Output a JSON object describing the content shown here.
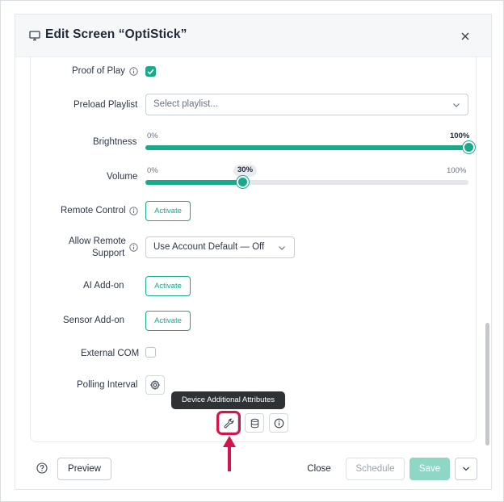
{
  "header": {
    "title": "Edit Screen “OptiStick”",
    "icons": {
      "title": "monitor-icon",
      "close": "close-icon"
    }
  },
  "settings": {
    "proof_of_play": {
      "label": "Proof of Play",
      "checked": true
    },
    "preload_playlist": {
      "label": "Preload Playlist",
      "placeholder": "Select playlist..."
    },
    "brightness": {
      "label": "Brightness",
      "min_label": "0%",
      "max_label": "100%",
      "value_percent": 100
    },
    "volume": {
      "label": "Volume",
      "min_label": "0%",
      "max_label": "100%",
      "value_label": "30%",
      "value_percent": 30
    },
    "remote_control": {
      "label": "Remote Control",
      "button": "Activate"
    },
    "allow_remote_support": {
      "label_line1": "Allow Remote",
      "label_line2": "Support",
      "selected": "Use Account Default — Off"
    },
    "ai_addon": {
      "label": "AI Add-on",
      "button": "Activate"
    },
    "sensor_addon": {
      "label": "Sensor Add-on",
      "button": "Activate"
    },
    "external_com": {
      "label": "External COM",
      "checked": false
    },
    "polling_interval": {
      "label": "Polling Interval",
      "icon": "gear-icon"
    }
  },
  "attribute_tools": {
    "tooltip": "Device Additional Attributes",
    "icons": [
      "wrench-icon",
      "database-icon",
      "info-icon"
    ]
  },
  "footer": {
    "preview": "Preview",
    "close": "Close",
    "schedule": "Schedule",
    "save": "Save",
    "icons": {
      "help": "help-icon",
      "more": "chevron-down-icon"
    }
  },
  "colors": {
    "accent": "#19a98b",
    "accent_disabled": "#8fd7c5",
    "highlight": "#d3154a",
    "tooltip_bg": "#2f3235"
  }
}
